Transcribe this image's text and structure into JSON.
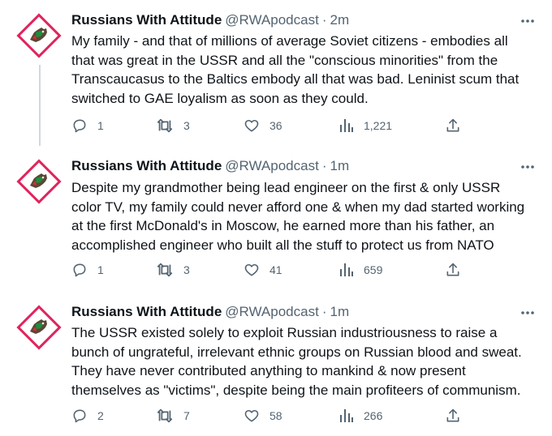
{
  "tweets": [
    {
      "name": "Russians With Attitude",
      "handle": "@RWApodcast",
      "separator": "·",
      "time": "2m",
      "text": "My family - and that of millions of average Soviet citizens - embodies all\nthat was great in the USSR and all the \"conscious minorities\" from the\nTranscaucasus to the Baltics embody all that was bad. Leninist scum that\nswitched to GAE loyalism as soon as they could.",
      "replies": "1",
      "retweets": "3",
      "likes": "36",
      "views": "1,221"
    },
    {
      "name": "Russians With Attitude",
      "handle": "@RWApodcast",
      "separator": "·",
      "time": "1m",
      "text": "Despite my grandmother being lead engineer on the first & only USSR\ncolor TV, my family could never afford one & when my dad started working\nat the first McDonald's in Moscow, he earned more than his father, an\naccomplished engineer who built all the stuff to protect us from NATO",
      "replies": "1",
      "retweets": "3",
      "likes": "41",
      "views": "659"
    },
    {
      "name": "Russians With Attitude",
      "handle": "@RWApodcast",
      "separator": "·",
      "time": "1m",
      "text": "The USSR existed solely to exploit Russian industriousness to raise a\nbunch of ungrateful, irrelevant ethnic groups on Russian blood and sweat.\nThey have never contributed anything to mankind & now present\nthemselves as \"victims\", despite being the main profiteers of communism.",
      "replies": "2",
      "retweets": "7",
      "likes": "58",
      "views": "266"
    }
  ],
  "icons": {
    "avatar": "warning-diamond-wolf-avatar",
    "more": "more-dots-icon",
    "reply": "reply-icon",
    "retweet": "retweet-icon",
    "like": "heart-icon",
    "views": "views-bar-chart-icon",
    "share": "share-icon"
  },
  "colors": {
    "text": "#0f1419",
    "secondary": "#536471",
    "thread_line": "#cfd9de",
    "avatar_border": "#e0245e",
    "avatar_bg": "#ffffff"
  }
}
